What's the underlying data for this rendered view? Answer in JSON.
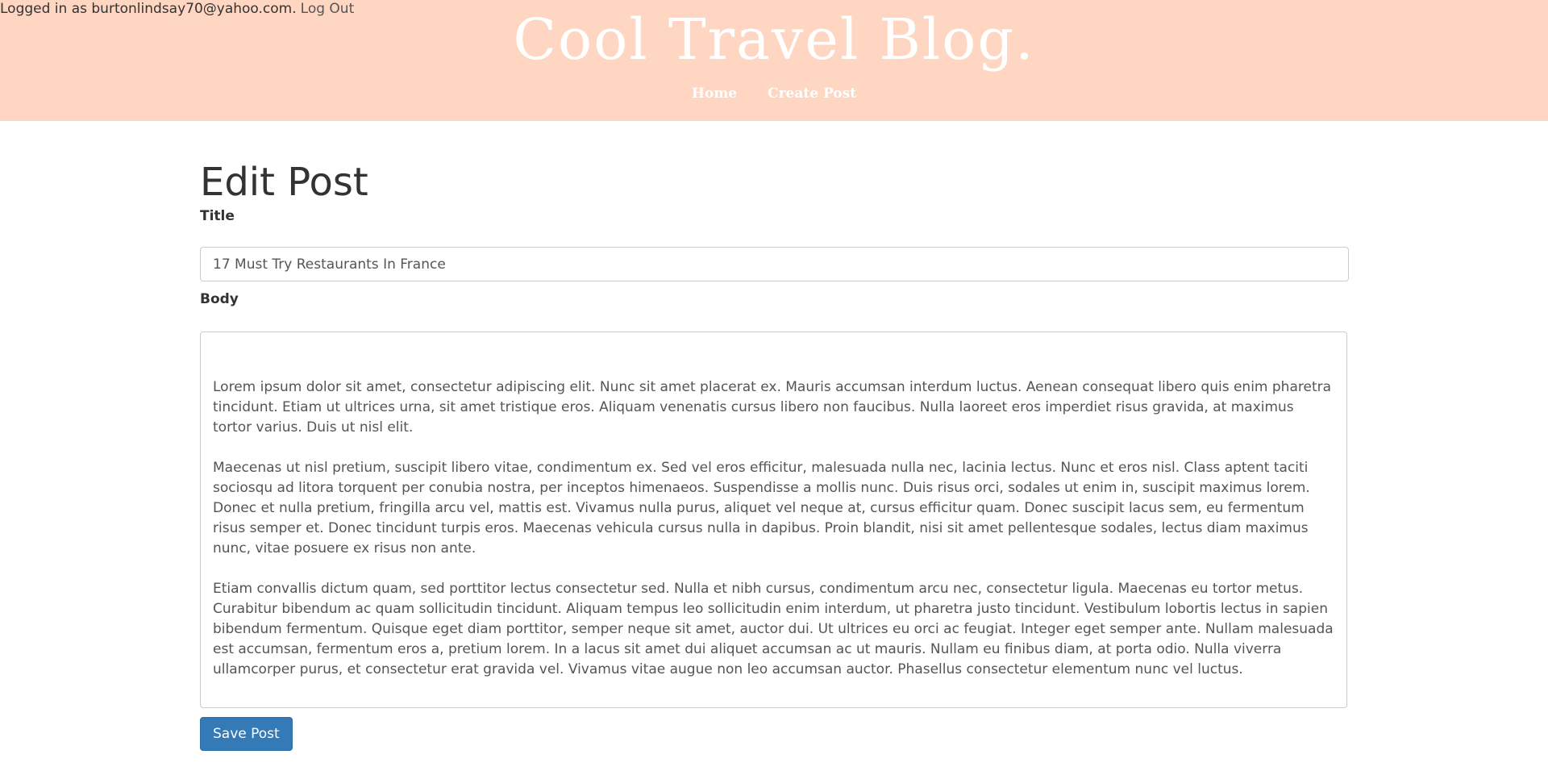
{
  "header": {
    "login_text": "Logged in as burtonlindsay70@yahoo.com.",
    "logout_label": "Log Out",
    "site_title": "Cool Travel Blog.",
    "nav": {
      "home": "Home",
      "create_post": "Create Post"
    },
    "background_color": "#fed6c2"
  },
  "form": {
    "heading": "Edit Post",
    "title_label": "Title",
    "title_value": "17 Must Try Restaurants In France",
    "body_label": "Body",
    "body_value": "Lorem ipsum dolor sit amet, consectetur adipiscing elit. Nunc sit amet placerat ex. Mauris accumsan interdum luctus. Aenean consequat libero quis enim pharetra tincidunt. Etiam ut ultrices urna, sit amet tristique eros. Aliquam venenatis cursus libero non faucibus. Nulla laoreet eros imperdiet risus gravida, at maximus tortor varius. Duis ut nisl elit.\n\nMaecenas ut nisl pretium, suscipit libero vitae, condimentum ex. Sed vel eros efficitur, malesuada nulla nec, lacinia lectus. Nunc et eros nisl. Class aptent taciti sociosqu ad litora torquent per conubia nostra, per inceptos himenaeos. Suspendisse a mollis nunc. Duis risus orci, sodales ut enim in, suscipit maximus lorem. Donec et nulla pretium, fringilla arcu vel, mattis est. Vivamus nulla purus, aliquet vel neque at, cursus efficitur quam. Donec suscipit lacus sem, eu fermentum risus semper et. Donec tincidunt turpis eros. Maecenas vehicula cursus nulla in dapibus. Proin blandit, nisi sit amet pellentesque sodales, lectus diam maximus nunc, vitae posuere ex risus non ante.\n\nEtiam convallis dictum quam, sed porttitor lectus consectetur sed. Nulla et nibh cursus, condimentum arcu nec, consectetur ligula. Maecenas eu tortor metus. Curabitur bibendum ac quam sollicitudin tincidunt. Aliquam tempus leo sollicitudin enim interdum, ut pharetra justo tincidunt. Vestibulum lobortis lectus in sapien bibendum fermentum. Quisque eget diam porttitor, semper neque sit amet, auctor dui. Ut ultrices eu orci ac feugiat. Integer eget semper ante. Nullam malesuada est accumsan, fermentum eros a, pretium lorem. In a lacus sit amet dui aliquet accumsan ac ut mauris. Nullam eu finibus diam, at porta odio. Nulla viverra ullamcorper purus, et consectetur erat gravida vel. Vivamus vitae augue non leo accumsan auctor. Phasellus consectetur elementum nunc vel luctus.",
    "save_label": "Save Post",
    "save_color": "#337ab7"
  }
}
